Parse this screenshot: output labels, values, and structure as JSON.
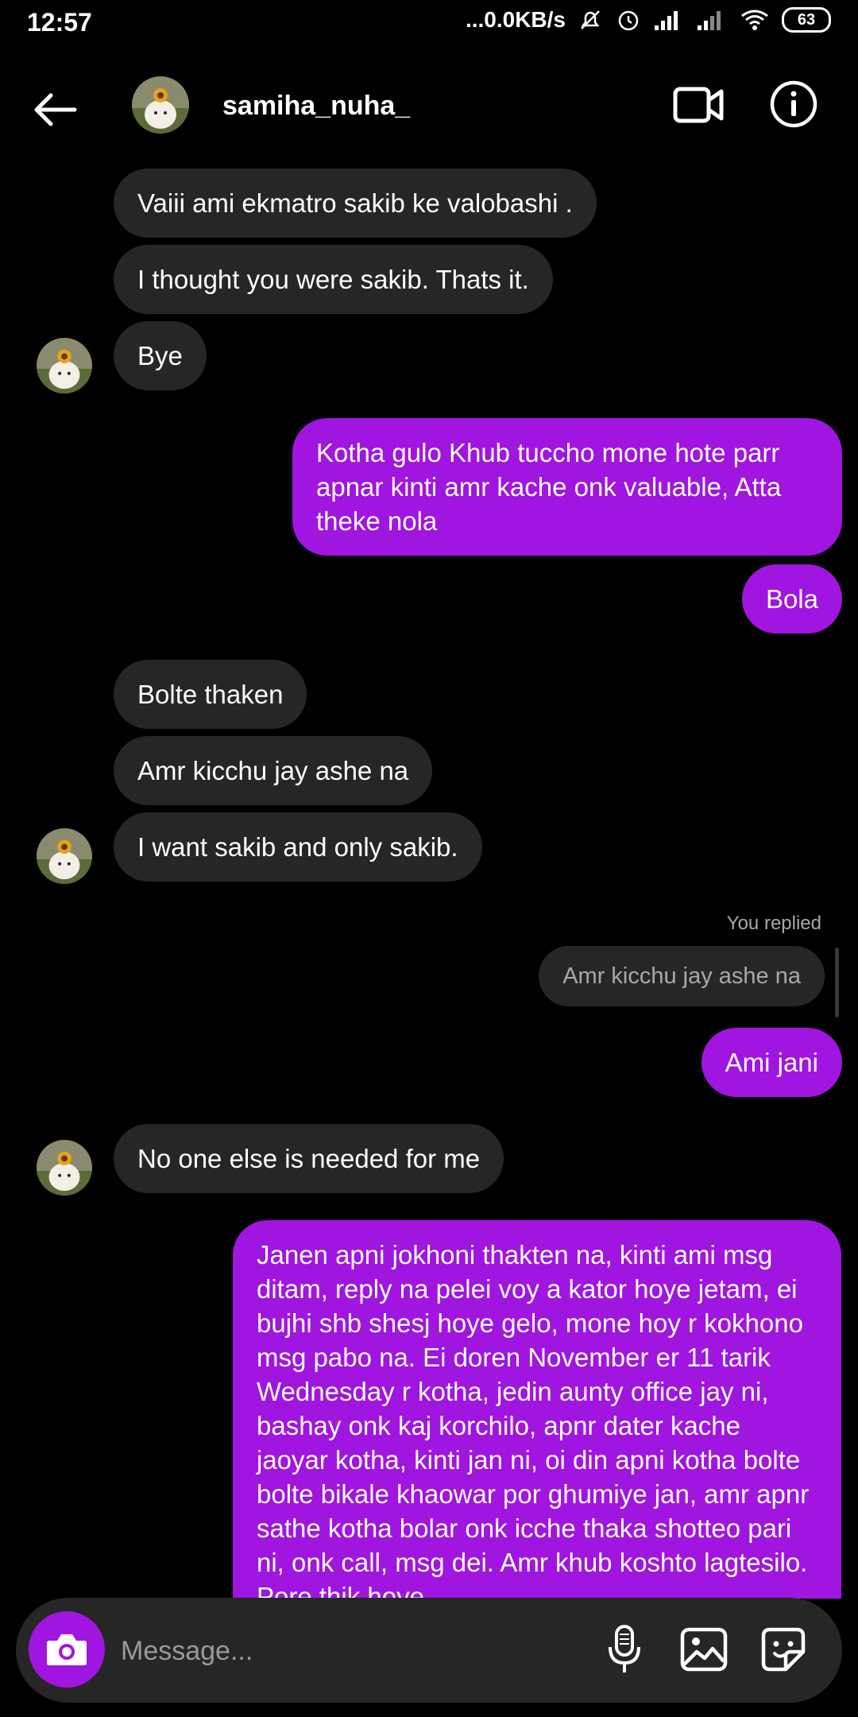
{
  "status_bar": {
    "time": "12:57",
    "net_speed": "...0.0KB/s",
    "battery": "63"
  },
  "header": {
    "username": "samiha_nuha_"
  },
  "messages": {
    "m1": "Vaiii ami ekmatro sakib ke valobashi .",
    "m2": "I thought you were sakib. Thats it.",
    "m3": "Bye",
    "m4": "Kotha gulo Khub tuccho mone hote parr apnar kinti amr kache onk valuable, Atta theke nola",
    "m5": "Bola",
    "m6": "Bolte thaken",
    "m7": "Amr kicchu jay ashe na",
    "m8": "I want sakib and only sakib.",
    "replied_label": "You replied",
    "reply_quote": "Amr kicchu jay ashe na",
    "m9": "Ami jani",
    "m10": "No one else is needed for me",
    "m11": "Janen apni jokhoni thakten na, kinti ami msg ditam, reply na pelei voy a kator hoye jetam, ei bujhi shb shesj hoye gelo, mone hoy r kokhono msg pabo na. Ei doren November er 11 tarik Wednesday r kotha, jedin aunty office jay ni, bashay onk kaj korchilo, apnr dater kache jaoyar kotha, kinti jan ni, oi din apni kotha bolte bolte bikale khaowar por ghumiye jan, amr apnr sathe kotha bolar onk icche thaka shotteo pari ni, onk call, msg dei. Amr khub koshto lagtesilo. Pore thik hoye"
  },
  "composer": {
    "placeholder": "Message..."
  },
  "colors": {
    "outgoing_bubble": "#a015df",
    "incoming_bubble": "#262626",
    "background": "#000000"
  },
  "icons": [
    "back-arrow-icon",
    "video-camera-icon",
    "info-icon",
    "camera-icon",
    "microphone-icon",
    "gallery-icon",
    "sticker-icon"
  ]
}
